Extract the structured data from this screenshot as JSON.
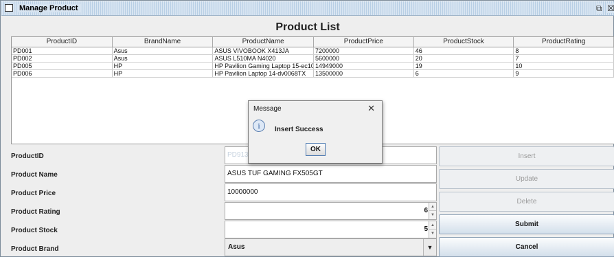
{
  "window": {
    "title": "Manage Product"
  },
  "heading": "Product List",
  "table": {
    "columns": [
      "ProductID",
      "BrandName",
      "ProductName",
      "ProductPrice",
      "ProductStock",
      "ProductRating"
    ],
    "rows": [
      [
        "PD001",
        "Asus",
        "ASUS VIVOBOOK X413JA",
        "7200000",
        "46",
        "8"
      ],
      [
        "PD002",
        "Asus",
        "ASUS L510MA N4020",
        "5600000",
        "20",
        "7"
      ],
      [
        "PD005",
        "HP",
        "HP Pavilion Gaming Laptop 15-ec10...",
        "14949000",
        "19",
        "10"
      ],
      [
        "PD006",
        "HP",
        "HP Pavilion Laptop 14-dv0068TX",
        "13500000",
        "6",
        "9"
      ]
    ]
  },
  "form": {
    "product_id_label": "ProductID",
    "product_id_value": "PD913",
    "product_name_label": "Product Name",
    "product_name_value": "ASUS TUF GAMING FX505GT",
    "product_price_label": "Product Price",
    "product_price_value": "10000000",
    "product_rating_label": "Product Rating",
    "product_rating_value": "6",
    "product_stock_label": "Product Stock",
    "product_stock_value": "5",
    "product_brand_label": "Product Brand",
    "product_brand_value": "Asus"
  },
  "buttons": {
    "insert": "Insert",
    "update": "Update",
    "delete": "Delete",
    "submit": "Submit",
    "cancel": "Cancel"
  },
  "dialog": {
    "title": "Message",
    "message": "Insert Success",
    "ok": "OK",
    "close_glyph": "✕",
    "info_glyph": "i"
  },
  "icons": {
    "restore": "⧉",
    "close": "☒",
    "spin_up": "▲",
    "spin_down": "▼",
    "dropdown": "▼"
  }
}
